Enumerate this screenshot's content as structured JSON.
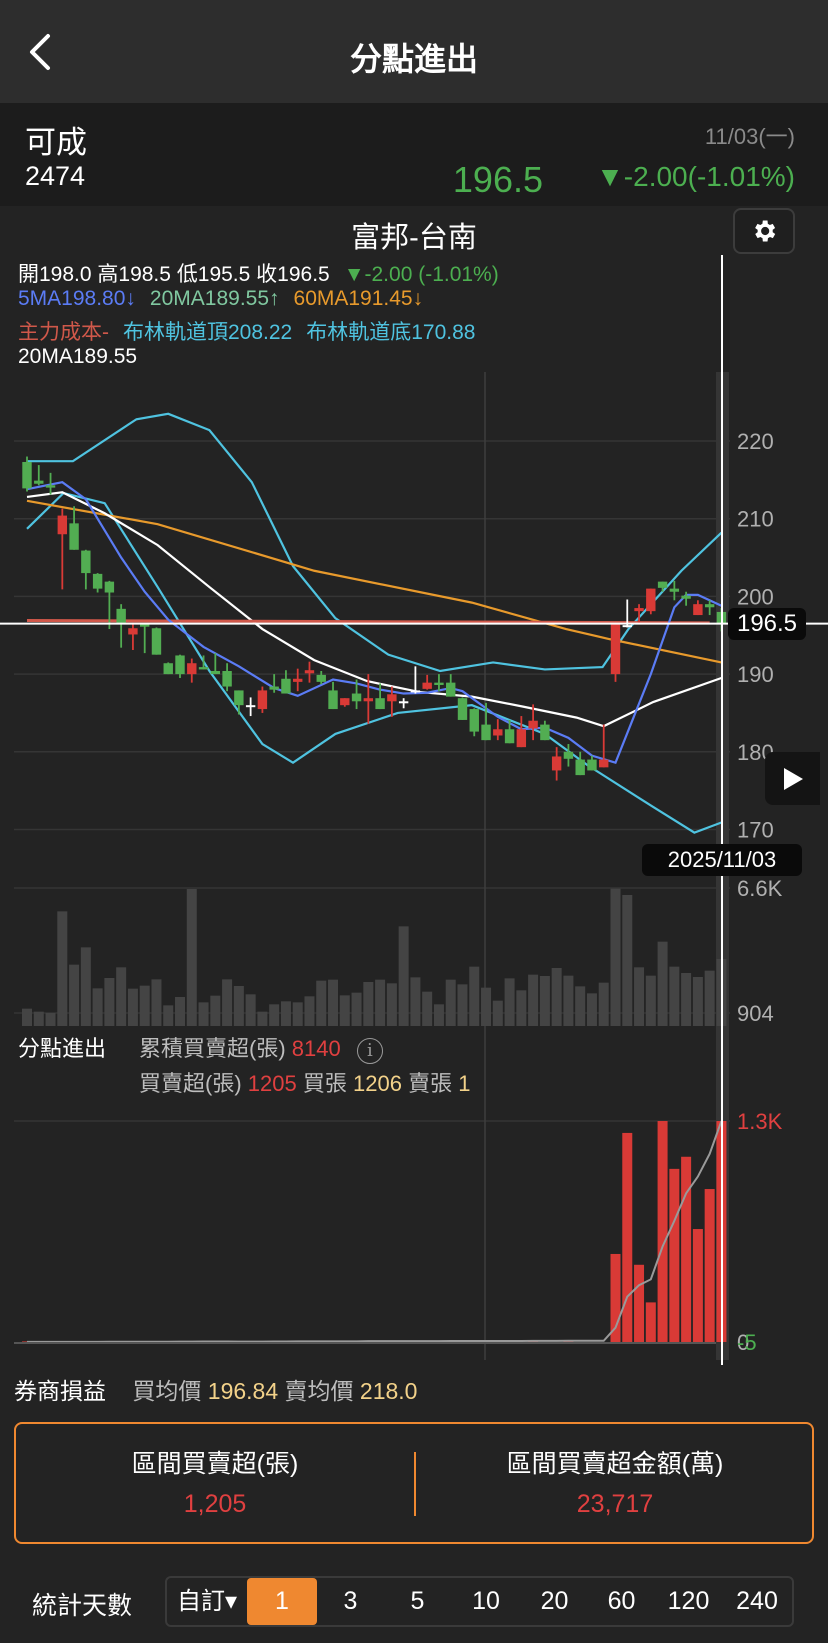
{
  "header": {
    "title": "分點進出",
    "back_icon": "chevron-left-icon"
  },
  "stock": {
    "name": "可成",
    "code": "2474",
    "date": "11/03(一)",
    "price": "196.5",
    "change": "▼-2.00(-1.01%)"
  },
  "chart": {
    "broker": "富邦-台南",
    "ohlc": "開198.0 高198.5 低195.5 收196.5",
    "ohlc_change": "▼-2.00 (-1.01%)",
    "ma5": "5MA198.80↓",
    "ma20": "20MA189.55↑",
    "ma60": "60MA191.45↓",
    "main_cost": "主力成本-",
    "boll_top": "布林軌道頂208.22",
    "boll_bottom": "布林軌道底170.88",
    "ma20_line": "20MA189.55",
    "crosshair_date": "2025/11/03",
    "crosshair_price": "196.5",
    "colors": {
      "up": "#d93a36",
      "down": "#52ad52",
      "ma5": "#5b7cf5",
      "ma20": "#ffffff",
      "ma60": "#e89a2c",
      "boll": "#4fc3e0",
      "cost": "#d0584a"
    }
  },
  "net_panel": {
    "label": "分點進出",
    "cum_label": "累積買賣超(張)",
    "cum_value": "8140",
    "net_label": "買賣超(張)",
    "net_value": "1205",
    "buy_label": "買張",
    "buy_value": "1206",
    "sell_label": "賣張",
    "sell_value": "1"
  },
  "broker_pl": {
    "label": "券商損益",
    "buy_avg_label": "買均價",
    "buy_avg": "196.84",
    "sell_avg_label": "賣均價",
    "sell_avg": "218.0"
  },
  "summary": {
    "net_label": "區間買賣超(張)",
    "net_value": "1,205",
    "amount_label": "區間買賣超金額(萬)",
    "amount_value": "23,717"
  },
  "stats": {
    "label": "統計天數",
    "custom": "自訂▾",
    "options": [
      "1",
      "3",
      "5",
      "10",
      "20",
      "60",
      "120",
      "240"
    ],
    "selected": "1"
  },
  "chart_data": [
    {
      "type": "candlestick",
      "title": "富邦-台南",
      "y_ticks": [
        "220",
        "210",
        "200",
        "190",
        "180",
        "170"
      ],
      "ylim": [
        170,
        220
      ],
      "candles_ohlc": [
        [
          217.3,
          218,
          213.5,
          213.9
        ],
        [
          214.9,
          216.9,
          214.3,
          214.5
        ],
        [
          214.3,
          215.9,
          213.1,
          214.0
        ],
        [
          208.0,
          211.3,
          200.9,
          210.4
        ],
        [
          209.4,
          211.6,
          206.0,
          206.0
        ],
        [
          205.9,
          206,
          200.9,
          203.0
        ],
        [
          202.9,
          203,
          200.5,
          201.0
        ],
        [
          201.9,
          202,
          195.8,
          200.5
        ],
        [
          198.4,
          199,
          193.4,
          196.6
        ],
        [
          195.1,
          196.6,
          193.1,
          195.9
        ],
        [
          196.4,
          196.5,
          192.7,
          196.1
        ],
        [
          195.9,
          196,
          192.5,
          192.5
        ],
        [
          191.4,
          191.5,
          190.0,
          190.0
        ],
        [
          192.4,
          192.5,
          189.5,
          190.0
        ],
        [
          190.0,
          192.0,
          188.9,
          191.4
        ],
        [
          190.9,
          192.4,
          190.6,
          190.6
        ],
        [
          190.4,
          192.7,
          190.0,
          190.0
        ],
        [
          190.4,
          191.4,
          187.8,
          188.4
        ],
        [
          187.9,
          187.9,
          184.8,
          186.0
        ],
        [
          186.0,
          187.0,
          184.6,
          186.0
        ],
        [
          185.5,
          188.4,
          185.0,
          187.9
        ],
        [
          188.4,
          190.0,
          187.6,
          188.0
        ],
        [
          189.4,
          190.5,
          187.5,
          187.5
        ],
        [
          189.0,
          190.7,
          187.8,
          189.4
        ],
        [
          190.1,
          191.6,
          188.9,
          190.5
        ],
        [
          189.9,
          190.4,
          188.7,
          189.0
        ],
        [
          187.9,
          189.0,
          185.5,
          185.5
        ],
        [
          186.0,
          186.9,
          185.8,
          186.9
        ],
        [
          187.5,
          189.3,
          185.5,
          186.5
        ],
        [
          186.5,
          190.0,
          183.6,
          186.9
        ],
        [
          186.9,
          188.8,
          185.5,
          185.5
        ],
        [
          186.5,
          188.4,
          184.5,
          187.4
        ],
        [
          186.5,
          186.9,
          185.6,
          186.5
        ],
        [
          187.9,
          191.0,
          187.5,
          187.9
        ],
        [
          188.1,
          189.9,
          188.0,
          188.9
        ],
        [
          188.9,
          190.0,
          187.8,
          188.6
        ],
        [
          188.9,
          190.0,
          187.1,
          187.1
        ],
        [
          186.9,
          187.0,
          184.1,
          184.1
        ],
        [
          185.5,
          185.6,
          182.0,
          182.6
        ],
        [
          183.5,
          186.3,
          181.5,
          181.5
        ],
        [
          182.1,
          184.2,
          181.5,
          182.9
        ],
        [
          182.9,
          184.1,
          181.1,
          181.1
        ],
        [
          180.6,
          184.6,
          180.6,
          182.9
        ],
        [
          183.0,
          186.1,
          181.5,
          184.0
        ],
        [
          183.5,
          184.0,
          181.5,
          181.5
        ],
        [
          177.6,
          180.6,
          176.3,
          179.4
        ],
        [
          180.0,
          181.0,
          178.1,
          179.1
        ],
        [
          179.0,
          180.0,
          177.0,
          177.0
        ],
        [
          179.0,
          179.5,
          177.6,
          177.6
        ],
        [
          178.0,
          183.5,
          178.0,
          179.0
        ],
        [
          190.0,
          196.4,
          189.0,
          196.4
        ],
        [
          196.3,
          199.6,
          196.0,
          196.3
        ],
        [
          198.1,
          199.0,
          196.5,
          198.5
        ],
        [
          198.1,
          201.0,
          197.7,
          201.0
        ],
        [
          201.9,
          201.9,
          200.6,
          201.1
        ],
        [
          201.0,
          202.0,
          199.5,
          200.6
        ],
        [
          200.1,
          200.6,
          198.8,
          199.7
        ],
        [
          197.6,
          199.5,
          197.6,
          199.0
        ],
        [
          199.0,
          199.5,
          197.6,
          198.6
        ],
        [
          198.0,
          198.5,
          195.5,
          196.5
        ]
      ],
      "lines": {
        "ma5": [
          [
            0,
            213.8
          ],
          [
            3,
            214.7
          ],
          [
            5,
            212.5
          ],
          [
            8,
            205
          ],
          [
            10,
            200.6
          ],
          [
            12,
            197
          ],
          [
            15,
            193.5
          ],
          [
            18,
            191
          ],
          [
            21,
            188.2
          ],
          [
            23,
            187.2
          ],
          [
            26,
            189.3
          ],
          [
            28,
            188.8
          ],
          [
            30,
            188
          ],
          [
            32,
            187.5
          ],
          [
            34,
            187.6
          ],
          [
            36,
            188.2
          ],
          [
            37,
            187.8
          ],
          [
            40,
            184.5
          ],
          [
            42,
            182.9
          ],
          [
            44,
            183.1
          ],
          [
            46,
            181.8
          ],
          [
            48,
            179.5
          ],
          [
            50,
            178.6
          ],
          [
            53,
            190
          ],
          [
            55,
            198.6
          ],
          [
            56,
            200.2
          ],
          [
            57,
            200.2
          ],
          [
            59,
            198.8
          ]
        ],
        "ma20": [
          [
            0,
            212.8
          ],
          [
            3,
            213.4
          ],
          [
            6.6,
            210.7
          ],
          [
            11.1,
            206.6
          ],
          [
            15.5,
            201.2
          ],
          [
            20,
            195.8
          ],
          [
            24.4,
            191.8
          ],
          [
            28.9,
            189.1
          ],
          [
            33.3,
            187.7
          ],
          [
            37.8,
            187.1
          ],
          [
            42.2,
            185.8
          ],
          [
            46.7,
            184.4
          ],
          [
            49,
            183.3
          ],
          [
            53.2,
            186.4
          ],
          [
            59,
            189.5
          ]
        ],
        "ma60": [
          [
            0,
            212.3
          ],
          [
            11.1,
            209.3
          ],
          [
            24.4,
            203.3
          ],
          [
            37.8,
            199.2
          ],
          [
            45.8,
            195.8
          ],
          [
            49.5,
            194.5
          ],
          [
            59,
            191.5
          ]
        ],
        "boll_upper": [
          [
            0,
            217.4
          ],
          [
            3.9,
            217.4
          ],
          [
            9.3,
            222.8
          ],
          [
            12,
            223.5
          ],
          [
            15.5,
            221.4
          ],
          [
            19.1,
            214.7
          ],
          [
            22.6,
            203.9
          ],
          [
            26.2,
            197.2
          ],
          [
            30.7,
            192.5
          ],
          [
            35.1,
            190.4
          ],
          [
            39.6,
            191.5
          ],
          [
            44,
            190.6
          ],
          [
            48.9,
            190.9
          ],
          [
            51.1,
            195.8
          ],
          [
            55.6,
            203.3
          ],
          [
            59,
            208.2
          ]
        ],
        "boll_lower": [
          [
            0,
            208.7
          ],
          [
            3.1,
            213.3
          ],
          [
            6.6,
            212
          ],
          [
            11.1,
            201.2
          ],
          [
            15.5,
            190.4
          ],
          [
            20,
            181
          ],
          [
            22.6,
            178.6
          ],
          [
            26.2,
            182.3
          ],
          [
            31.5,
            185
          ],
          [
            37.8,
            186
          ],
          [
            44,
            182.3
          ],
          [
            47.6,
            178.3
          ],
          [
            53.2,
            172.9
          ],
          [
            56.7,
            169.6
          ],
          [
            59,
            170.9
          ]
        ],
        "main_cost": [
          [
            0,
            196.9
          ],
          [
            58,
            196.6
          ]
        ]
      }
    },
    {
      "type": "bar",
      "title": "volume",
      "y_ticks": [
        "6.6K",
        "904"
      ],
      "ylim": [
        904,
        6600
      ],
      "values": [
        1101,
        965,
        904,
        5537,
        3107,
        3896,
        2028,
        2499,
        2985,
        2013,
        2150,
        2438,
        1253,
        1633,
        6555,
        1390,
        1694,
        2438,
        2134,
        1755,
        965,
        1299,
        1436,
        1390,
        1664,
        2377,
        2423,
        1709,
        1831,
        2317,
        2423,
        2256,
        4853,
        2529,
        1876,
        1299,
        2423,
        2210,
        3015,
        2058,
        1466,
        2484,
        1937,
        2651,
        2590,
        2955,
        2605,
        2119,
        1800,
        2286,
        6570,
        6281,
        2985,
        2605,
        4155,
        3015,
        2727,
        2545,
        2833,
        3365
      ]
    },
    {
      "type": "bar",
      "title": "分點進出",
      "y_ticks": [
        "1.3K",
        "0",
        "-5"
      ],
      "ylim": [
        -5,
        1205
      ],
      "values": [
        3,
        0,
        2,
        0,
        0,
        -2,
        0,
        4,
        0,
        0,
        3,
        0,
        0,
        5,
        0,
        2,
        0,
        0,
        -1,
        0,
        0,
        3,
        0,
        4,
        0,
        0,
        2,
        0,
        0,
        5,
        0,
        0,
        3,
        0,
        0,
        0,
        4,
        0,
        0,
        2,
        0,
        0,
        0,
        3,
        0,
        0,
        2,
        0,
        0,
        0,
        480,
        1140,
        421,
        216,
        1205,
        944,
        1010,
        616,
        834,
        1205
      ]
    }
  ]
}
